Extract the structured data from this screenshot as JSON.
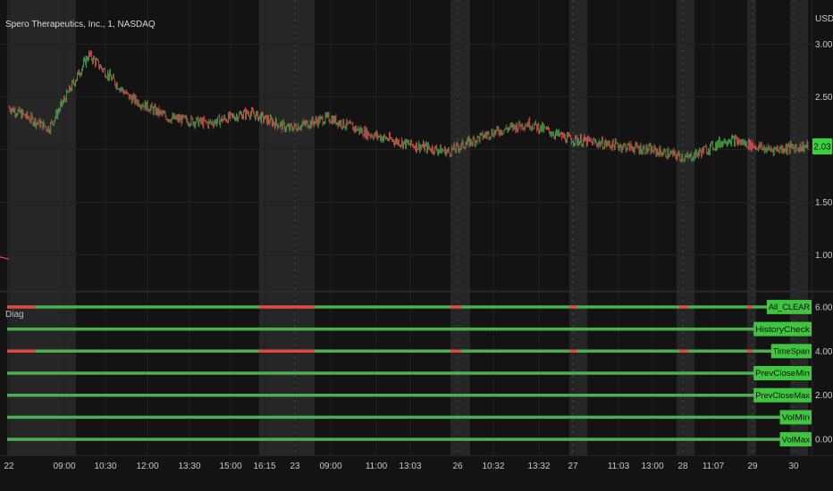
{
  "chart_data": [
    {
      "type": "line",
      "title": "Spero Therapeutics, Inc., 1, NASDAQ",
      "currency": "USD",
      "ylim": [
        0.75,
        3.25
      ],
      "y_ticks": [
        1.0,
        1.5,
        2.0,
        2.5,
        3.0
      ],
      "y_tick_labels": [
        "1.00",
        "1.50",
        "2.00",
        "2.50",
        "3.00"
      ],
      "last_price": 2.03,
      "last_price_label": "2.03",
      "colors": {
        "up": "#4caf50",
        "down": "#e35050",
        "label_bg": "#37d33c"
      },
      "x_tick_labels": [
        "22",
        "09:00",
        "10:30",
        "12:00",
        "13:30",
        "15:00",
        "16:15",
        "23",
        "09:00",
        "11:00",
        "13:03",
        "26",
        "10:32",
        "13:32",
        "27",
        "11:03",
        "13:00",
        "28",
        "11:07",
        "29",
        "30"
      ],
      "x": [
        "22",
        "09:00",
        "10:30",
        "12:00",
        "13:30",
        "15:00",
        "16:15",
        "23",
        "09:00",
        "11:00",
        "13:03",
        "26",
        "10:32",
        "13:32",
        "27",
        "11:03",
        "13:00",
        "28",
        "11:07",
        "29",
        "30"
      ],
      "series": [
        {
          "values": [
            2.4,
            2.2,
            2.9,
            2.5,
            2.3,
            2.25,
            2.35,
            2.2,
            2.3,
            2.15,
            2.05,
            1.98,
            2.15,
            2.25,
            2.1,
            2.05,
            2.0,
            1.92,
            2.1,
            2.0,
            2.03
          ]
        }
      ]
    },
    {
      "type": "line",
      "title": "Diag",
      "ylim": [
        -0.4,
        6.4
      ],
      "y_ticks": [
        0,
        2,
        4,
        6
      ],
      "y_tick_labels": [
        "0.00",
        "2.00",
        "4.00",
        "6.00"
      ],
      "colors": {
        "ok": "#4caf50",
        "fail": "#e04848",
        "tag_bg": "#3ec73e"
      },
      "series": [
        {
          "name": "All_CLEAR",
          "value": 6.0
        },
        {
          "name": "HistoryCheck",
          "value": 5.0
        },
        {
          "name": "TimeSpan",
          "value": 4.0
        },
        {
          "name": "PrevCloseMin",
          "value": 3.0
        },
        {
          "name": "PrevCloseMax",
          "value": 2.0
        },
        {
          "name": "VolMin",
          "value": 1.0
        },
        {
          "name": "VolMax",
          "value": 0.0
        }
      ]
    }
  ]
}
